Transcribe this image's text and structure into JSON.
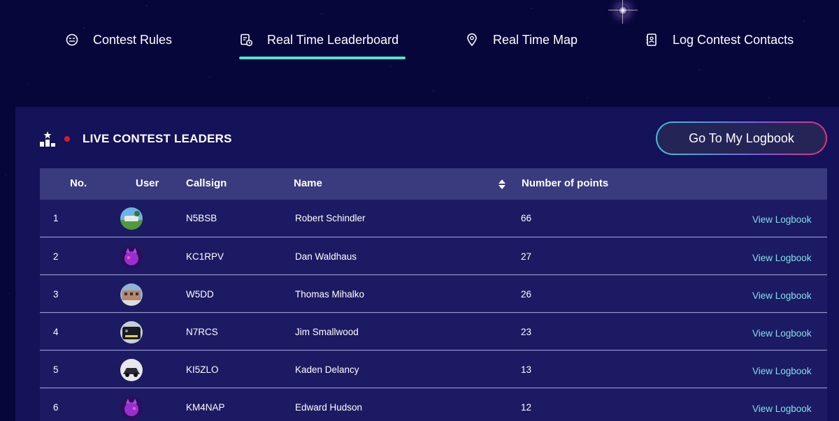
{
  "nav": {
    "items": [
      {
        "label": "Contest Rules"
      },
      {
        "label": "Real Time Leaderboard"
      },
      {
        "label": "Real Time Map"
      },
      {
        "label": "Log Contest Contacts"
      }
    ]
  },
  "panel": {
    "title": "LIVE CONTEST LEADERS",
    "logbook_button": "Go To My Logbook"
  },
  "table": {
    "headers": {
      "no": "No.",
      "user": "User",
      "callsign": "Callsign",
      "name": "Name",
      "points": "Number of points"
    },
    "rows": [
      {
        "no": "1",
        "callsign": "N5BSB",
        "name": "Robert Schindler",
        "points": "66",
        "action": "View Logbook"
      },
      {
        "no": "2",
        "callsign": "KC1RPV",
        "name": "Dan Waldhaus",
        "points": "27",
        "action": "View Logbook"
      },
      {
        "no": "3",
        "callsign": "W5DD",
        "name": "Thomas Mihalko",
        "points": "26",
        "action": "View Logbook"
      },
      {
        "no": "4",
        "callsign": "N7RCS",
        "name": "Jim Smallwood",
        "points": "23",
        "action": "View Logbook"
      },
      {
        "no": "5",
        "callsign": "KI5ZLO",
        "name": "Kaden Delancy",
        "points": "13",
        "action": "View Logbook"
      },
      {
        "no": "6",
        "callsign": "KM4NAP",
        "name": "Edward Hudson",
        "points": "12",
        "action": "View Logbook"
      }
    ]
  },
  "colors": {
    "background": "#07063a",
    "panel": "#141258",
    "accent": "#56e0c9",
    "live_dot": "#e0182a",
    "link": "#7fe0e8"
  }
}
